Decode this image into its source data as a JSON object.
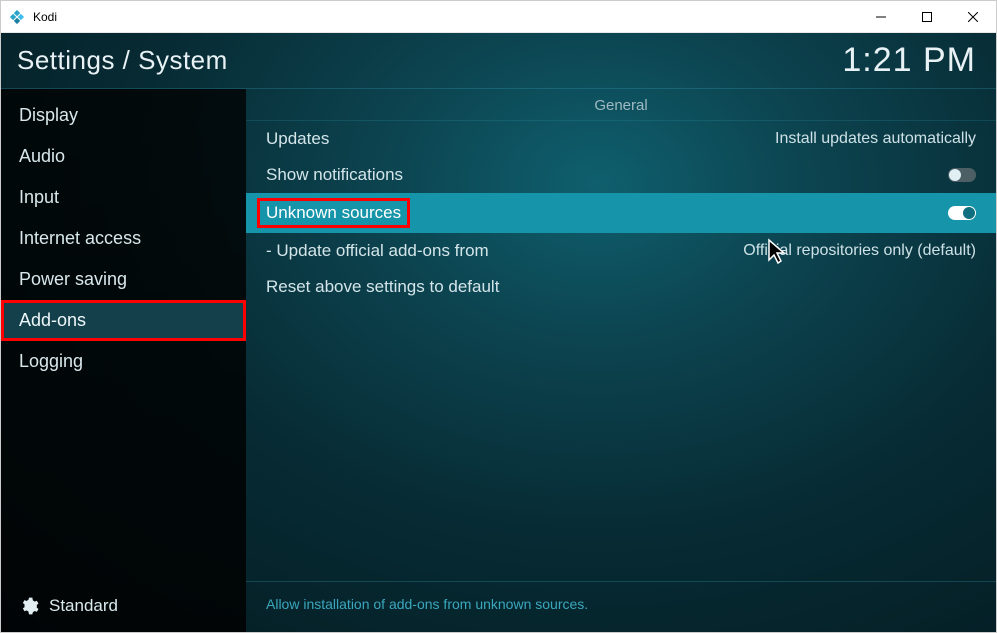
{
  "window": {
    "title": "Kodi"
  },
  "header": {
    "title": "Settings / System",
    "clock": "1:21 PM"
  },
  "sidebar": {
    "items": [
      {
        "label": "Display",
        "selected": false
      },
      {
        "label": "Audio",
        "selected": false
      },
      {
        "label": "Input",
        "selected": false
      },
      {
        "label": "Internet access",
        "selected": false
      },
      {
        "label": "Power saving",
        "selected": false
      },
      {
        "label": "Add-ons",
        "selected": true,
        "marked": true
      },
      {
        "label": "Logging",
        "selected": false
      }
    ],
    "level_label": "Standard"
  },
  "content": {
    "section_title": "General",
    "rows": [
      {
        "id": "updates",
        "label": "Updates",
        "type": "value",
        "value": "Install updates automatically"
      },
      {
        "id": "show-notifications",
        "label": "Show notifications",
        "type": "toggle",
        "on": false
      },
      {
        "id": "unknown-sources",
        "label": "Unknown sources",
        "type": "toggle",
        "on": true,
        "selected": true,
        "label_marked": true
      },
      {
        "id": "update-official",
        "label": "- Update official add-ons from",
        "type": "value",
        "value": "Official repositories only (default)"
      },
      {
        "id": "reset",
        "label": "Reset above settings to default",
        "type": "none"
      }
    ],
    "footer_hint": "Allow installation of add-ons from unknown sources."
  }
}
